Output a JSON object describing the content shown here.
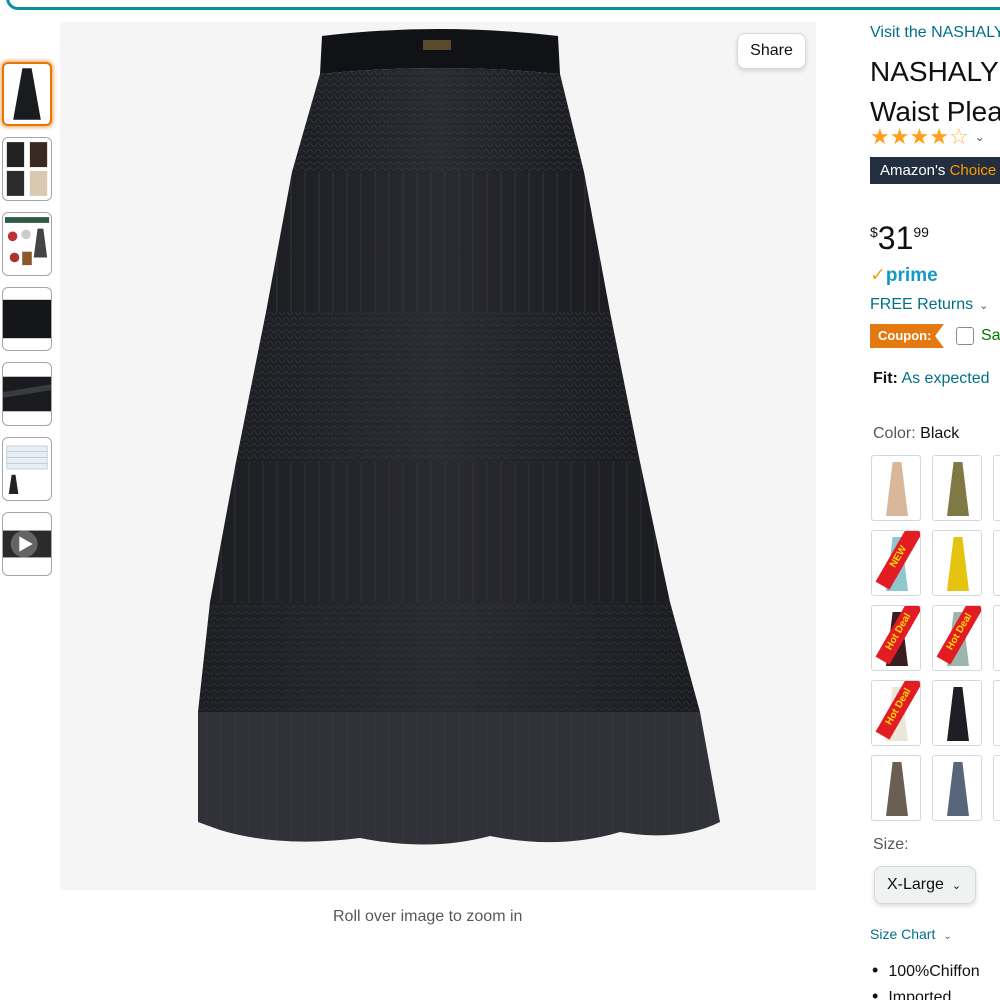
{
  "main_image": {
    "share_label": "Share",
    "zoom_hint": "Roll over image to zoom in"
  },
  "product": {
    "store_link": "Visit the NASHALY Store",
    "title_line1": "NASHALY",
    "title_line2": "Waist Plea",
    "rating_stars": 4.5,
    "amazons_choice_prefix": "Amazon's",
    "amazons_choice_suffix": "Choice",
    "price_symbol": "$",
    "price_whole": "31",
    "price_fraction": "99",
    "prime_label": "prime",
    "returns_label": "FREE Returns",
    "coupon_label": "Coupon:",
    "coupon_text": "Save",
    "fit_label": "Fit:",
    "fit_value": "As expected",
    "color_label": "Color:",
    "color_value": "Black",
    "size_label": "Size:",
    "size_value": "X-Large",
    "size_chart_label": "Size Chart",
    "bullets": [
      "100%Chiffon",
      "Imported"
    ]
  },
  "swatch_badges": {
    "new": "NEW",
    "hot": "Hot Deal"
  },
  "colors": {
    "link": "#007185",
    "price_text": "#0f1111",
    "accent_orange": "#e47911",
    "choice_bg": "#232f3e",
    "prime_blue": "#1399c6",
    "frame_teal": "#0d8e9e"
  }
}
